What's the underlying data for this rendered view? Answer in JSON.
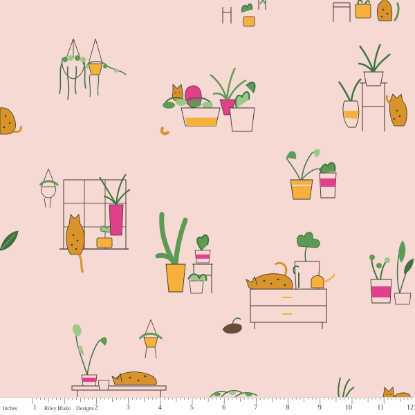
{
  "colors": {
    "background": "#f6d9d2",
    "leaf_green": "#5f9a55",
    "leaf_dark": "#3f7240",
    "leaf_light": "#9cc98a",
    "pot_orange": "#f5b13c",
    "pot_pink": "#e23f8c",
    "cat_orange": "#d8932a",
    "ink": "#3b3330"
  },
  "motifs": [
    {
      "name": "hanging-plants-motif",
      "icon": "hanging-planter-icon"
    },
    {
      "name": "cat-plant-shelf-motif",
      "icon": "cat-icon"
    },
    {
      "name": "tall-plants-cat-motif",
      "icon": "cat-icon"
    },
    {
      "name": "window-cat-motif",
      "icon": "window-icon"
    },
    {
      "name": "plant-stand-motif",
      "icon": "plant-stand-icon"
    },
    {
      "name": "two-pots-motif",
      "icon": "potted-plant-icon"
    },
    {
      "name": "dresser-cat-motif",
      "icon": "dresser-icon"
    },
    {
      "name": "bench-cat-motif",
      "icon": "bench-icon"
    }
  ],
  "ruler": {
    "unit_label": "Inches",
    "brand": "Riley Blake",
    "brand_suffix": "Designs",
    "numbers": [
      "1",
      "2",
      "3",
      "4",
      "5",
      "6",
      "7",
      "8",
      "9",
      "10",
      "11",
      "12"
    ]
  }
}
